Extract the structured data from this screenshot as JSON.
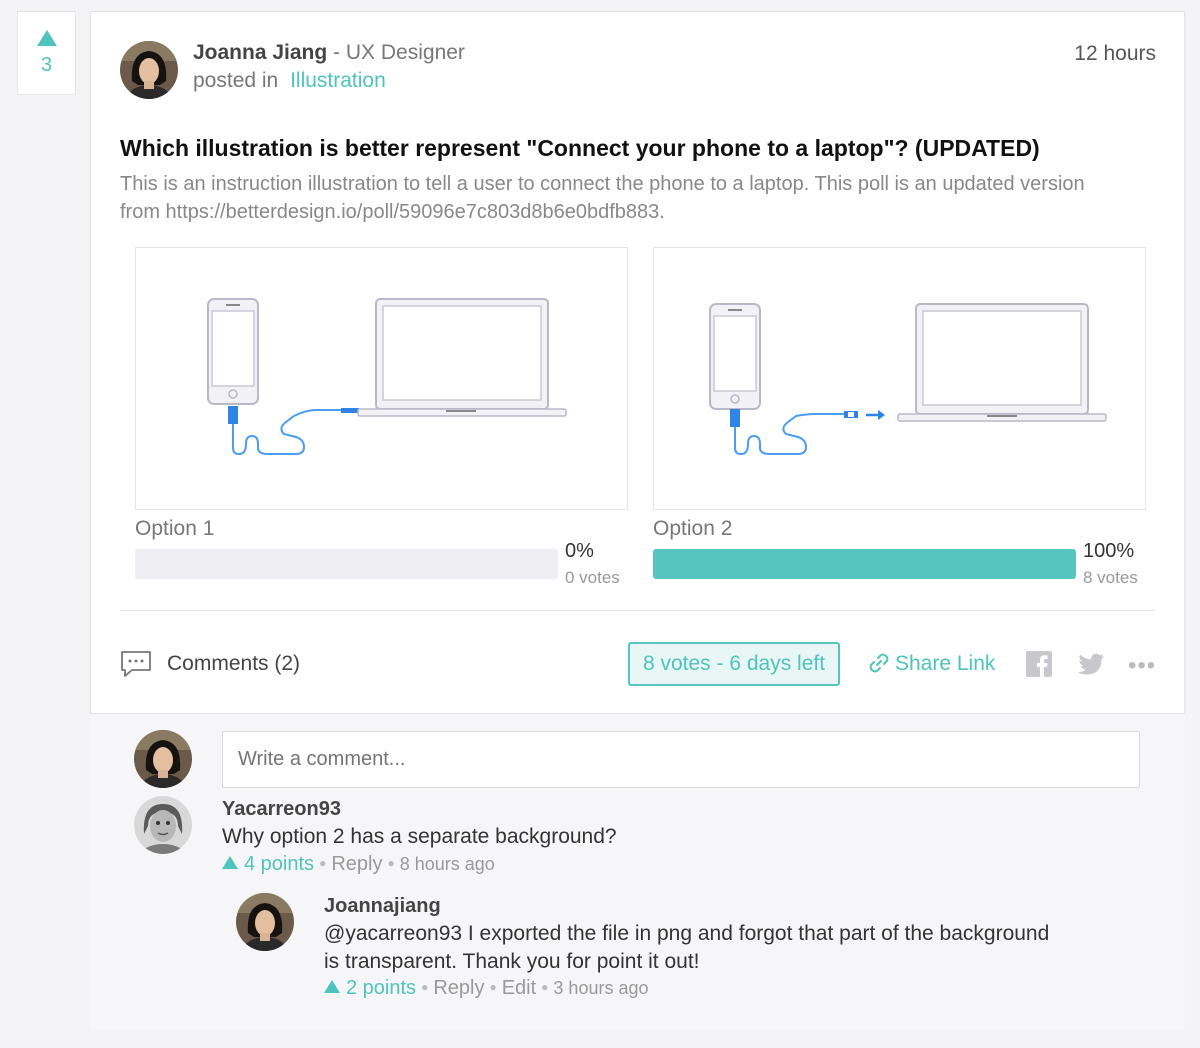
{
  "post": {
    "upvotes": "3",
    "author_name": "Joanna Jiang",
    "author_sep": " - ",
    "author_role": "UX Designer",
    "posted_in_label": "posted in",
    "category": "Illustration",
    "time": "12 hours",
    "title": "Which illustration is better represent \"Connect your phone to a laptop\"? (UPDATED)",
    "description": "This is an instruction illustration to tell a user to connect the phone to a laptop. This poll is an updated version from https://betterdesign.io/poll/59096e7c803d8b6e0bdfb883."
  },
  "options": [
    {
      "label": "Option 1",
      "percent_text": "0%",
      "votes_text": "0 votes",
      "fill": 0
    },
    {
      "label": "Option 2",
      "percent_text": "100%",
      "votes_text": "8 votes",
      "fill": 1
    }
  ],
  "footer": {
    "comments_label": "Comments (2)",
    "votes_status": "8 votes - 6 days left",
    "share_label": "Share Link"
  },
  "comment_input": {
    "placeholder": "Write a comment..."
  },
  "comments": [
    {
      "user": "Yacarreon93",
      "text": "Why option 2 has a separate background?",
      "points": "4 points",
      "reply": "Reply",
      "ago": "8 hours ago"
    },
    {
      "user": "Joannajiang",
      "text_line1": "@yacarreon93 I exported the file in png and forgot that part of the background",
      "text_line2": "is transparent. Thank you for point it out!",
      "points": "2 points",
      "reply": "Reply",
      "edit": "Edit",
      "ago": "3 hours ago"
    }
  ],
  "colors": {
    "accent": "#4fc3bd",
    "bar_fill": "#56c4bf",
    "bar_bg": "#eeeef3"
  }
}
